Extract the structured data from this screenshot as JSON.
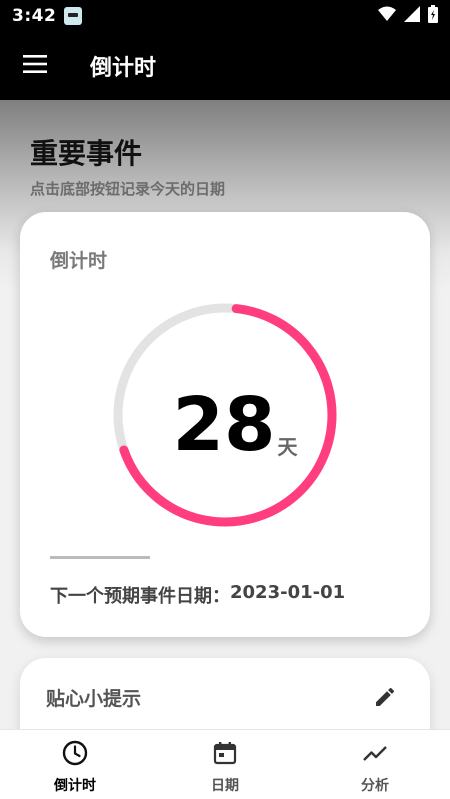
{
  "status_bar": {
    "time": "3:42"
  },
  "app_bar": {
    "title": "倒计时"
  },
  "hero": {
    "title": "重要事件",
    "subtitle": "点击底部按钮记录今天的日期"
  },
  "countdown_card": {
    "title": "倒计时",
    "days_value": "28",
    "days_unit": "天",
    "progress_fraction": 0.68,
    "ring_color": "#ff3d7f",
    "track_color": "#e3e3e3",
    "next_label": "下一个预期事件日期：",
    "next_date": "2023-01-01"
  },
  "tips_card": {
    "title": "贴心小提示"
  },
  "bottom_nav": {
    "items": [
      {
        "label": "倒计时",
        "icon": "clock-icon",
        "active": true
      },
      {
        "label": "日期",
        "icon": "calendar-icon",
        "active": false
      },
      {
        "label": "分析",
        "icon": "trending-up-icon",
        "active": false
      }
    ]
  }
}
